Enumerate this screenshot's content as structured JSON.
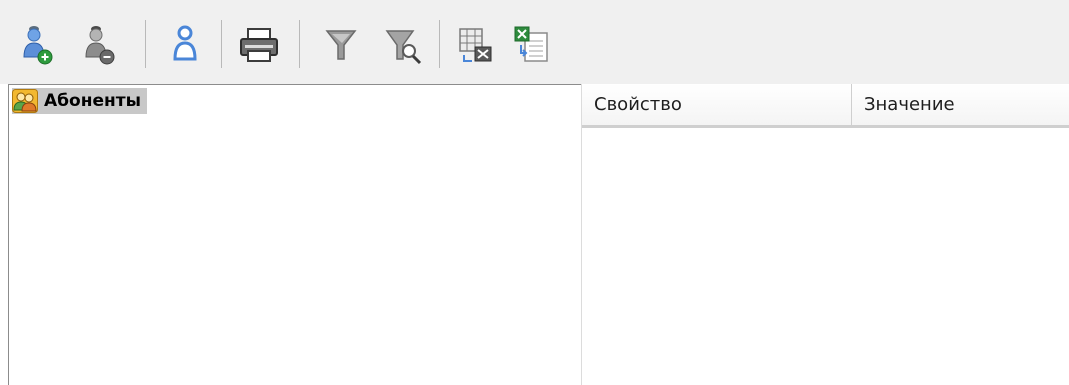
{
  "toolbar": {
    "buttons": [
      {
        "icon": "add-user-icon"
      },
      {
        "icon": "remove-user-icon"
      },
      {
        "icon": "user-icon"
      },
      {
        "icon": "printer-icon"
      },
      {
        "icon": "filter-icon"
      },
      {
        "icon": "filter-search-icon"
      },
      {
        "icon": "export-excel-icon"
      },
      {
        "icon": "import-excel-icon"
      }
    ]
  },
  "tree": {
    "root_label": "Абоненты",
    "root_icon": "subscribers-group-icon"
  },
  "properties": {
    "columns": [
      "Свойство",
      "Значение"
    ]
  },
  "colors": {
    "toolbar_bg": "#f0f0f0",
    "selection_bg": "#c8c8c8",
    "accent_blue": "#3b7fd6",
    "excel_green": "#2e8b3d"
  }
}
